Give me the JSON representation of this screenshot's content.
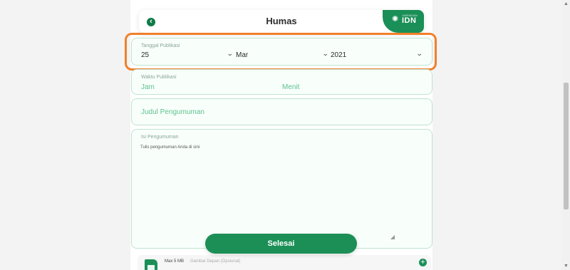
{
  "header": {
    "title": "Humas",
    "back_icon": "chevron-left-icon",
    "brand": {
      "small": "JARINGAN",
      "name": "IDN"
    }
  },
  "date_field": {
    "label": "Tanggal Publikasi",
    "day": "25",
    "month": "Mar",
    "year": "2021"
  },
  "time_field": {
    "label": "Waktu Publikasi",
    "hour_placeholder": "Jam",
    "minute_placeholder": "Menit"
  },
  "title_field": {
    "placeholder": "Judul Pengumuman"
  },
  "body_field": {
    "label": "Isi Pengumuman",
    "placeholder": "Tulis pengumuman Anda di sini"
  },
  "submit": {
    "label": "Selesai"
  },
  "attachment": {
    "max": "Max 5 MB",
    "placeholder": "Gambar Depan (Opsional)"
  },
  "colors": {
    "primary": "#1b8f56",
    "highlight": "#f0802b",
    "placeholder": "#5ec08d"
  }
}
